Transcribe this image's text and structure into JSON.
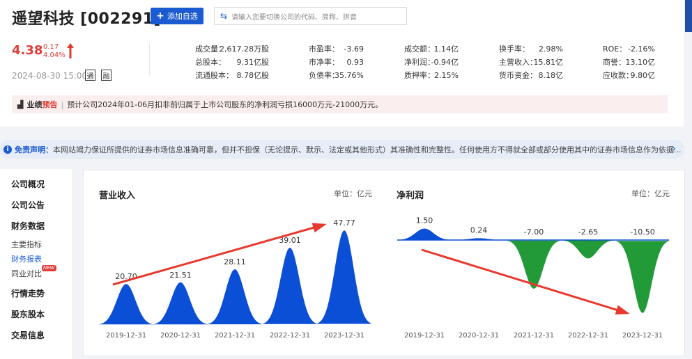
{
  "header": {
    "stock_title": "遥望科技 [002291]",
    "add_button": "添加自选",
    "add_icon": "plus-icon",
    "search_placeholder": "请输入您要切换公司的代码、简称、拼音"
  },
  "quote": {
    "price": "4.38",
    "change": "0.17",
    "change_pct": "4.04%",
    "datetime": "2024-08-30 15:00",
    "badge1": "通",
    "badge2": "融",
    "up_color": "#e23b35"
  },
  "stats": [
    [
      {
        "label": "成交量：",
        "value": "2,617.28万股"
      },
      {
        "label": "市盈率：",
        "value": "-3.69"
      },
      {
        "label": "成交额：",
        "value": "1.14亿"
      },
      {
        "label": "换手率：",
        "value": "2.98%"
      },
      {
        "label": "ROE：",
        "value": "-2.16%"
      }
    ],
    [
      {
        "label": "总股本：",
        "value": "9.31亿股"
      },
      {
        "label": "市净率：",
        "value": "0.93"
      },
      {
        "label": "净利润：",
        "value": "-0.94亿"
      },
      {
        "label": "主营收入：",
        "value": "15.81亿"
      },
      {
        "label": "商誉：",
        "value": "13.10亿"
      }
    ],
    [
      {
        "label": "流通股本：",
        "value": "8.78亿股"
      },
      {
        "label": "负债率：",
        "value": "35.76%"
      },
      {
        "label": "质押率：",
        "value": "2.15%"
      },
      {
        "label": "货币资金：",
        "value": "8.18亿"
      },
      {
        "label": "应收款：",
        "value": "9.80亿"
      }
    ]
  ],
  "notice": {
    "label_left": "业绩",
    "label_right": "预告",
    "separator": "|",
    "text": "预计公司2024年01-06月扣非前归属于上市公司股东的净利润亏损16000万元-21000万元。"
  },
  "disclaimer": {
    "label": "免责声明：",
    "text": "本网站竭力保证所提供的证券市场信息准确可靠，但并不担保（无论提示、默示、法定或其他形式）其准确性和完整性。任何使用方不得就全部或部分使用其中的证券市场信息作为依据..."
  },
  "sidebar": {
    "items": [
      {
        "label": "公司概况",
        "kind": "main"
      },
      {
        "label": "公司公告",
        "kind": "main"
      },
      {
        "label": "财务数据",
        "kind": "main"
      },
      {
        "label": "主要指标",
        "kind": "sub"
      },
      {
        "label": "财务报表",
        "kind": "sub-active"
      },
      {
        "label": "同业对比",
        "kind": "sub"
      },
      {
        "label": "行情走势",
        "kind": "main"
      },
      {
        "label": "股东股本",
        "kind": "main"
      },
      {
        "label": "交易信息",
        "kind": "main"
      }
    ],
    "new_badge": "NEW"
  },
  "chart_data": [
    {
      "type": "area",
      "title": "营业收入",
      "unit": "单位：亿元",
      "categories": [
        "2019-12-31",
        "2020-12-31",
        "2021-12-31",
        "2022-12-31",
        "2023-12-31"
      ],
      "values": [
        20.7,
        21.51,
        28.11,
        39.01,
        47.77
      ],
      "labels": [
        "20.70",
        "21.51",
        "28.11",
        "39.01",
        "47.77"
      ],
      "color": "#0b4fd6",
      "trend_arrow": "up",
      "arrow_color": "#e8392e"
    },
    {
      "type": "area",
      "title": "净利润",
      "unit": "单位：亿元",
      "categories": [
        "2019-12-31",
        "2020-12-31",
        "2021-12-31",
        "2022-12-31",
        "2023-12-31"
      ],
      "values": [
        1.5,
        0.24,
        -7.0,
        -2.65,
        -10.5
      ],
      "labels": [
        "1.50",
        "0.24",
        "-7.00",
        "-2.65",
        "-10.50"
      ],
      "positive_color": "#0b4fd6",
      "negative_color": "#229a38",
      "trend_arrow": "down",
      "arrow_color": "#e8392e"
    }
  ]
}
